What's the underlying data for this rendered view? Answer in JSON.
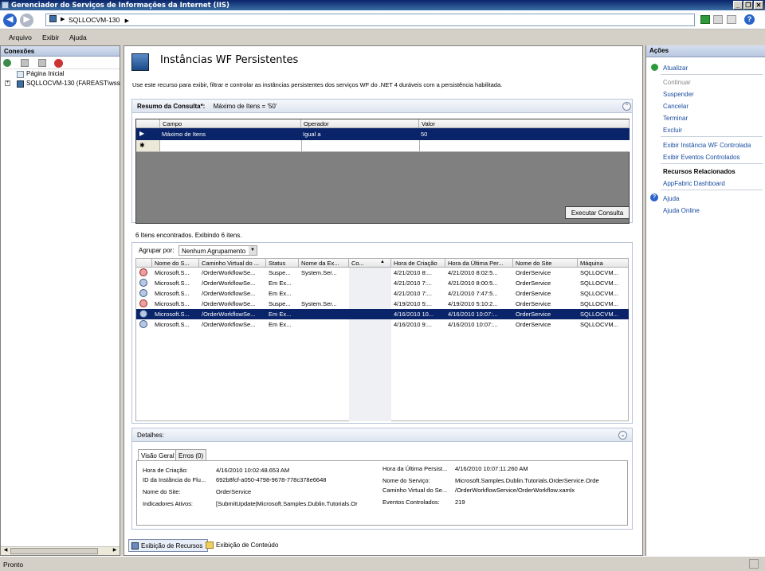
{
  "window": {
    "title": "Gerenciador do Serviços de Informações da Internet (IIS)"
  },
  "address": {
    "path_root": "SQLLOCVM-130",
    "sep": "▶"
  },
  "menu": [
    "Arquivo",
    "Exibir",
    "Ajuda"
  ],
  "connections": {
    "title": "Conexões",
    "tree": [
      {
        "label": "Página Inicial"
      },
      {
        "label": "SQLLOCVM-130 (FAREAST\\wssbu"
      }
    ]
  },
  "main": {
    "title": "Instâncias WF Persistentes",
    "description": "Use este recurso para exibir, filtrar e controlar as instâncias persistentes dos serviços WF do .NET 4 duráveis com a persistência habilitada.",
    "query_summary_label": "Resumo da Consulta*:",
    "query_summary_value": "Máximo de Itens = '50'",
    "query_headers": [
      "Campo",
      "Operador",
      "Valor"
    ],
    "query_row": [
      "Máximo de Itens",
      "Igual a",
      "50"
    ],
    "new_row_marker": "✱",
    "execute_button": "Executar Consulta",
    "results_text": "6 Itens encontrados. Exibindo 6 itens.",
    "group_label": "Agrupar por:",
    "group_value": "Nenhum Agrupamento",
    "columns": [
      "Nome do S...",
      "Caminho Virtual do ...",
      "Status",
      "Nome da Ex...",
      "Co...",
      "Hora de Criação",
      "Hora da Última Per...",
      "Nome do Site",
      "Máquina"
    ],
    "rows": [
      [
        "Microsoft.S...",
        "/OrderWorkflowSe...",
        "Suspe...",
        "System.Ser...",
        "",
        "4/21/2010 8:...",
        "4/21/2010 8:02:5...",
        "OrderService",
        "SQLLOCVM..."
      ],
      [
        "Microsoft.S...",
        "/OrderWorkflowSe...",
        "Em Ex...",
        "",
        "",
        "4/21/2010 7:...",
        "4/21/2010 8:00:5...",
        "OrderService",
        "SQLLOCVM..."
      ],
      [
        "Microsoft.S...",
        "/OrderWorkflowSe...",
        "Em Ex...",
        "",
        "",
        "4/21/2010 7:...",
        "4/21/2010 7:47:5...",
        "OrderService",
        "SQLLOCVM..."
      ],
      [
        "Microsoft.S...",
        "/OrderWorkflowSe...",
        "Suspe...",
        "System.Ser...",
        "",
        "4/19/2010 5:...",
        "4/19/2010 5:10:2...",
        "OrderService",
        "SQLLOCVM..."
      ],
      [
        "Microsoft.S...",
        "/OrderWorkflowSe...",
        "Em Ex...",
        "",
        "",
        "4/16/2010 10...",
        "4/16/2010 10:07:...",
        "OrderService",
        "SQLLOCVM..."
      ],
      [
        "Microsoft.S...",
        "/OrderWorkflowSe...",
        "Em Ex...",
        "",
        "",
        "4/16/2010 9:...",
        "4/16/2010 10:07:...",
        "OrderService",
        "SQLLOCVM..."
      ]
    ],
    "details_title": "Detalhes:",
    "details_tabs": [
      "Visão Geral",
      "Erros (0)"
    ],
    "details_left": [
      {
        "k": "Hora de Criação:",
        "v": "4/16/2010 10:02:48.653 AM"
      },
      {
        "k": "ID da Instância do Flu...",
        "v": "692b8fcf-a050-4798-9678-778c378e6648"
      },
      {
        "k": "Nome do Site:",
        "v": "OrderService"
      },
      {
        "k": "Indicadores Ativos:",
        "v": "[SubmitUpdate|Microsoft.Samples.Dublin.Tutorials.Or"
      }
    ],
    "details_right": [
      {
        "k": "Hora da Última Persist...",
        "v": "4/16/2010 10:07:11.260 AM"
      },
      {
        "k": "Nome do Serviço:",
        "v": "Microsoft.Samples.Dublin.Tutorials.OrderService.Orde"
      },
      {
        "k": "Caminho Virtual do Se...",
        "v": "/OrderWorkflowService/OrderWorkflow.xamlx"
      },
      {
        "k": "Eventos Controlados:",
        "v": "219"
      }
    ],
    "bottom_tabs": [
      "Exibição de Recursos",
      "Exibição de Conteúdo"
    ]
  },
  "actions": {
    "title": "Ações",
    "refresh": "Atualizar",
    "continue": "Continuar",
    "suspend": "Suspender",
    "cancel": "Cancelar",
    "terminate": "Terminar",
    "delete": "Excluir",
    "view_instance": "Exibir Instância WF Controlada",
    "view_events": "Exibir Eventos Controlados",
    "related_title": "Recursos Relacionados",
    "appfabric": "AppFabric Dashboard",
    "help": "Ajuda",
    "help_online": "Ajuda Online"
  },
  "status": {
    "text": "Pronto"
  },
  "selected_row": 4
}
